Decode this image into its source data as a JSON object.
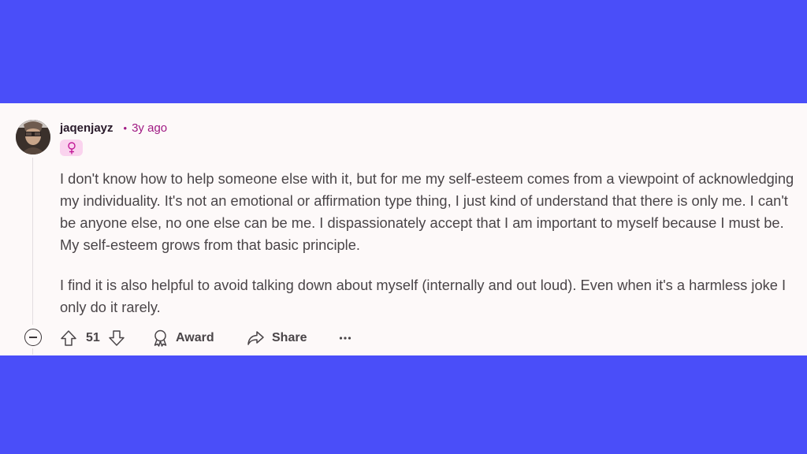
{
  "colors": {
    "background": "#4a4ef9",
    "card": "#fdf9f9",
    "username": "#2a1b2b",
    "timestamp": "#a01983",
    "flair_bg": "#fad3ee",
    "flair_icon": "#c21997",
    "body_text": "#4a4548"
  },
  "comment": {
    "username": "jaqenjayz",
    "separator": "•",
    "timestamp": "3y ago",
    "flair_icon": "female-symbol-icon",
    "paragraphs": [
      "I don't know how to help someone else with it, but for me my self-esteem comes from a viewpoint of acknowledging my individuality. It's not an emotional or affirmation type thing, I just kind of understand that there is only me. I can't be anyone else, no one else can be me. I dispassionately accept that I am important to myself because I must be. My self-esteem grows from that basic principle.",
      "I find it is also helpful to avoid talking down about myself (internally and out loud). Even when it's a harmless joke I only do it rarely."
    ]
  },
  "actions": {
    "collapse_icon": "minus-circle-icon",
    "upvote_icon": "arrow-up-icon",
    "vote_count": "51",
    "downvote_icon": "arrow-down-icon",
    "award_icon": "award-ribbon-icon",
    "award_label": "Award",
    "share_icon": "share-arrow-icon",
    "share_label": "Share",
    "more_icon": "ellipsis-icon"
  }
}
